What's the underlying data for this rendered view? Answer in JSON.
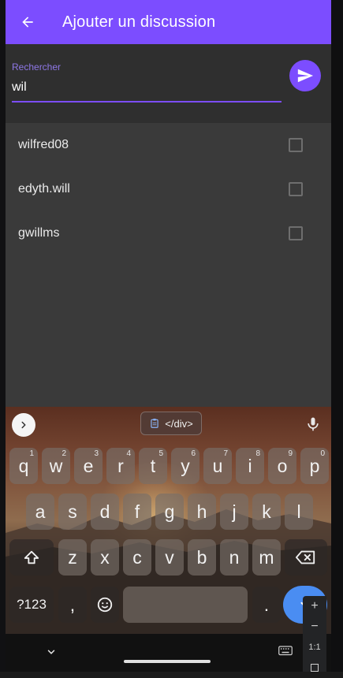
{
  "appbar": {
    "title": "Ajouter un discussion"
  },
  "search": {
    "label": "Rechercher",
    "value": "wil"
  },
  "results": [
    {
      "name": "wilfred08",
      "checked": false
    },
    {
      "name": "edyth.will",
      "checked": false
    },
    {
      "name": "gwillms",
      "checked": false
    }
  ],
  "keyboard": {
    "clipboard_text": "</div>",
    "row1": [
      {
        "k": "q",
        "h": "1"
      },
      {
        "k": "w",
        "h": "2"
      },
      {
        "k": "e",
        "h": "3"
      },
      {
        "k": "r",
        "h": "4"
      },
      {
        "k": "t",
        "h": "5"
      },
      {
        "k": "y",
        "h": "6"
      },
      {
        "k": "u",
        "h": "7"
      },
      {
        "k": "i",
        "h": "8"
      },
      {
        "k": "o",
        "h": "9"
      },
      {
        "k": "p",
        "h": "0"
      }
    ],
    "row2": [
      "a",
      "s",
      "d",
      "f",
      "g",
      "h",
      "j",
      "k",
      "l"
    ],
    "row3": [
      "z",
      "x",
      "c",
      "v",
      "b",
      "n",
      "m"
    ],
    "symbols_label": "?123",
    "comma_label": ",",
    "period_label": "."
  },
  "zoom": {
    "plus": "+",
    "minus": "−",
    "ratio": "1:1"
  },
  "colors": {
    "accent": "#7c4dff",
    "enter_key": "#4a8df2"
  }
}
